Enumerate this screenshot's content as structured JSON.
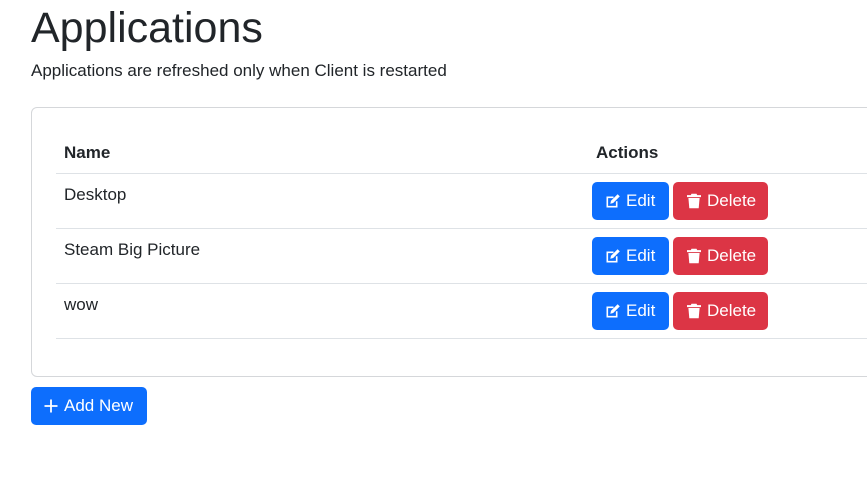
{
  "page": {
    "title": "Applications",
    "subtitle": "Applications are refreshed only when Client is restarted"
  },
  "table": {
    "headers": {
      "name": "Name",
      "actions": "Actions"
    },
    "rows": [
      {
        "name": "Desktop",
        "edit_label": "Edit",
        "delete_label": "Delete"
      },
      {
        "name": "Steam Big Picture",
        "edit_label": "Edit",
        "delete_label": "Delete"
      },
      {
        "name": "wow",
        "edit_label": "Edit",
        "delete_label": "Delete"
      }
    ]
  },
  "add_button": {
    "label": "Add New",
    "icon": "plus-icon"
  },
  "icons": {
    "edit": "edit-icon",
    "delete": "trash-icon"
  },
  "colors": {
    "primary": "#0d6efd",
    "danger": "#dc3545",
    "text": "#212529",
    "border": "#dee2e6"
  }
}
